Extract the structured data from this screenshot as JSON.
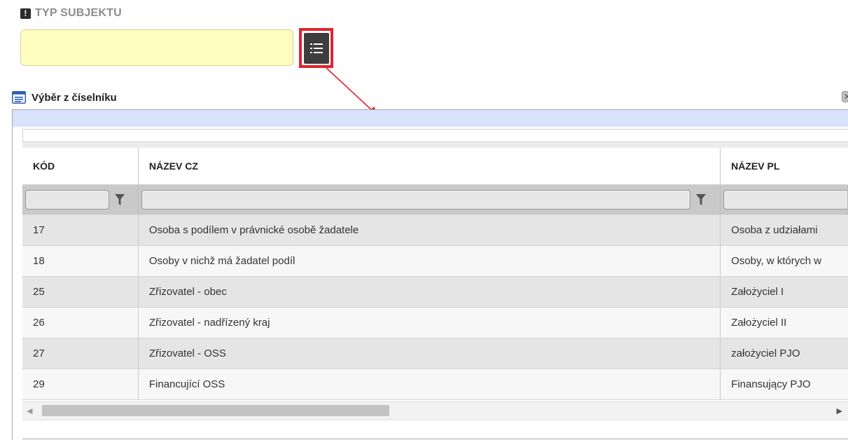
{
  "field": {
    "label": "TYP SUBJEKTU",
    "value": ""
  },
  "dialog": {
    "title": "Výběr z číselníku",
    "close_symbol": "✕"
  },
  "grid": {
    "columns": [
      "KÓD",
      "NÁZEV CZ",
      "NÁZEV PL"
    ],
    "rows": [
      {
        "code": "17",
        "name_cz": "Osoba s podílem v právnické osobě žadatele",
        "name_pl": "Osoba z udziałami"
      },
      {
        "code": "18",
        "name_cz": "Osoby v nichž má žadatel podíl",
        "name_pl": "Osoby, w których w"
      },
      {
        "code": "25",
        "name_cz": "Zřizovatel - obec",
        "name_pl": "Założyciel I"
      },
      {
        "code": "26",
        "name_cz": "Zřizovatel - nadřízený kraj",
        "name_pl": "Założyciel II"
      },
      {
        "code": "27",
        "name_cz": "Zřizovatel - OSS",
        "name_pl": "założyciel PJO"
      },
      {
        "code": "29",
        "name_cz": "Financující OSS",
        "name_pl": "Finansujący PJO"
      }
    ]
  },
  "scrollbar": {
    "left_arrow": "◀",
    "right_arrow": "▶"
  },
  "colors": {
    "highlight": "#e0232d",
    "input_bg": "#fffcc0",
    "header_band": "#d9e3fb"
  },
  "icons": {
    "required": "exclamation-icon",
    "list_button": "list-icon",
    "dialog": "window-list-icon",
    "filter": "funnel-icon"
  }
}
